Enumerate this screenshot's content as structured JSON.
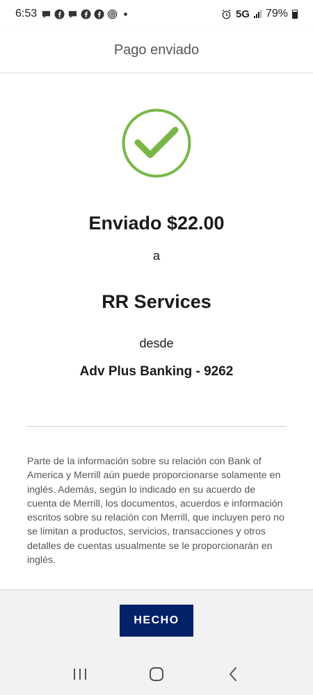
{
  "status_bar": {
    "time": "6:53",
    "network": "5G",
    "battery": "79%",
    "notification_icons": [
      "chat-bubble-icon",
      "facebook-icon",
      "chat-bubble-icon",
      "facebook-icon",
      "facebook-icon",
      "fingerprint-icon",
      "dot-icon"
    ],
    "system_icons": [
      "alarm-icon",
      "signal-icon",
      "battery-icon"
    ]
  },
  "header": {
    "title": "Pago enviado"
  },
  "confirmation": {
    "icon": "checkmark-circle-icon",
    "success_color": "#78b748",
    "amount_text": "Enviado $22.00",
    "to_text": "a",
    "recipient": "RR Services",
    "from_text": "desde",
    "account": "Adv Plus Banking - 9262"
  },
  "disclaimer": "Parte de la información sobre su relación con Bank of America y Merrill aún puede proporcionarse solamente en inglés. Además, según lo indicado en su acuerdo de cuenta de Merrill, los documentos, acuerdos e información escritos sobre su relación con Merrill, que incluyen pero no se limitan a productos, servicios, transacciones y otros detalles de cuentas usualmente se le proporcionarán en inglés.",
  "footer": {
    "done_label": "HECHO",
    "button_color": "#012169"
  },
  "nav_bar": {
    "buttons": [
      "recent-apps-icon",
      "home-icon",
      "back-icon"
    ]
  }
}
